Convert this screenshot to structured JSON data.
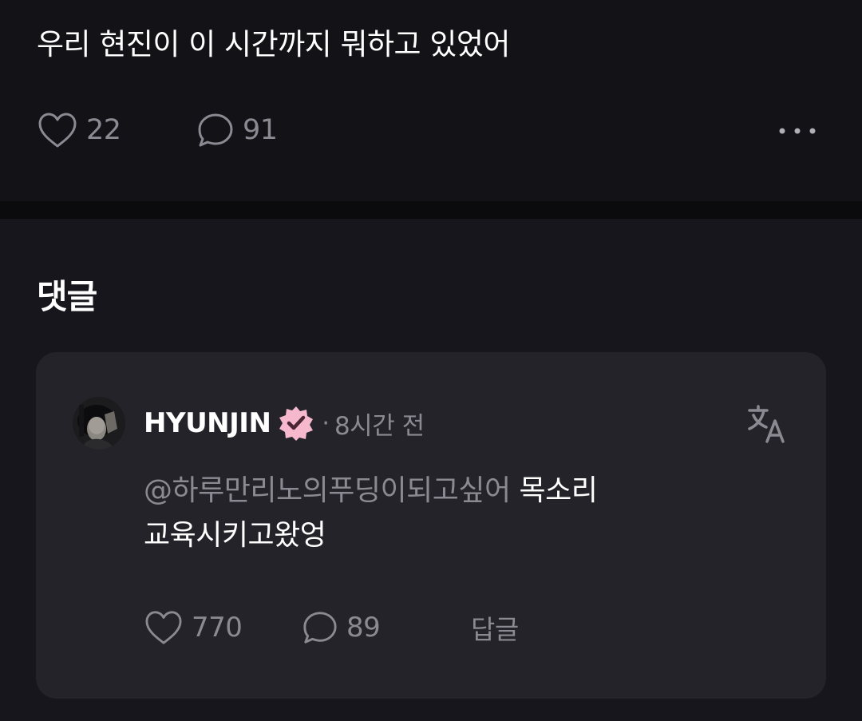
{
  "post": {
    "text": "우리 현진이 이 시간까지 뭐하고 있었어",
    "like_icon": "heart-outline-icon",
    "like_count": "22",
    "comment_icon": "speech-bubble-icon",
    "comment_count": "91",
    "more_icon": "more-dots-icon"
  },
  "comments": {
    "title": "댓글",
    "items": [
      {
        "author": "HYUNJIN",
        "verified_icon": "verified-badge-icon",
        "verified_color": "#f5b8cc",
        "dot": "·",
        "time": "8시간 전",
        "translate_icon": "translate-icon",
        "mention": "@하루만리노의푸딩이되고싶어",
        "text_line1": "목소리",
        "text_line2": "교육시키고왔엉",
        "like_count": "770",
        "reply_count": "89",
        "reply_label": "답글"
      }
    ]
  },
  "colors": {
    "background": "#17161c",
    "post_background": "#131217",
    "card_background": "#242329",
    "muted_text": "#8b8a92",
    "badge_pink": "#f5b8cc"
  }
}
